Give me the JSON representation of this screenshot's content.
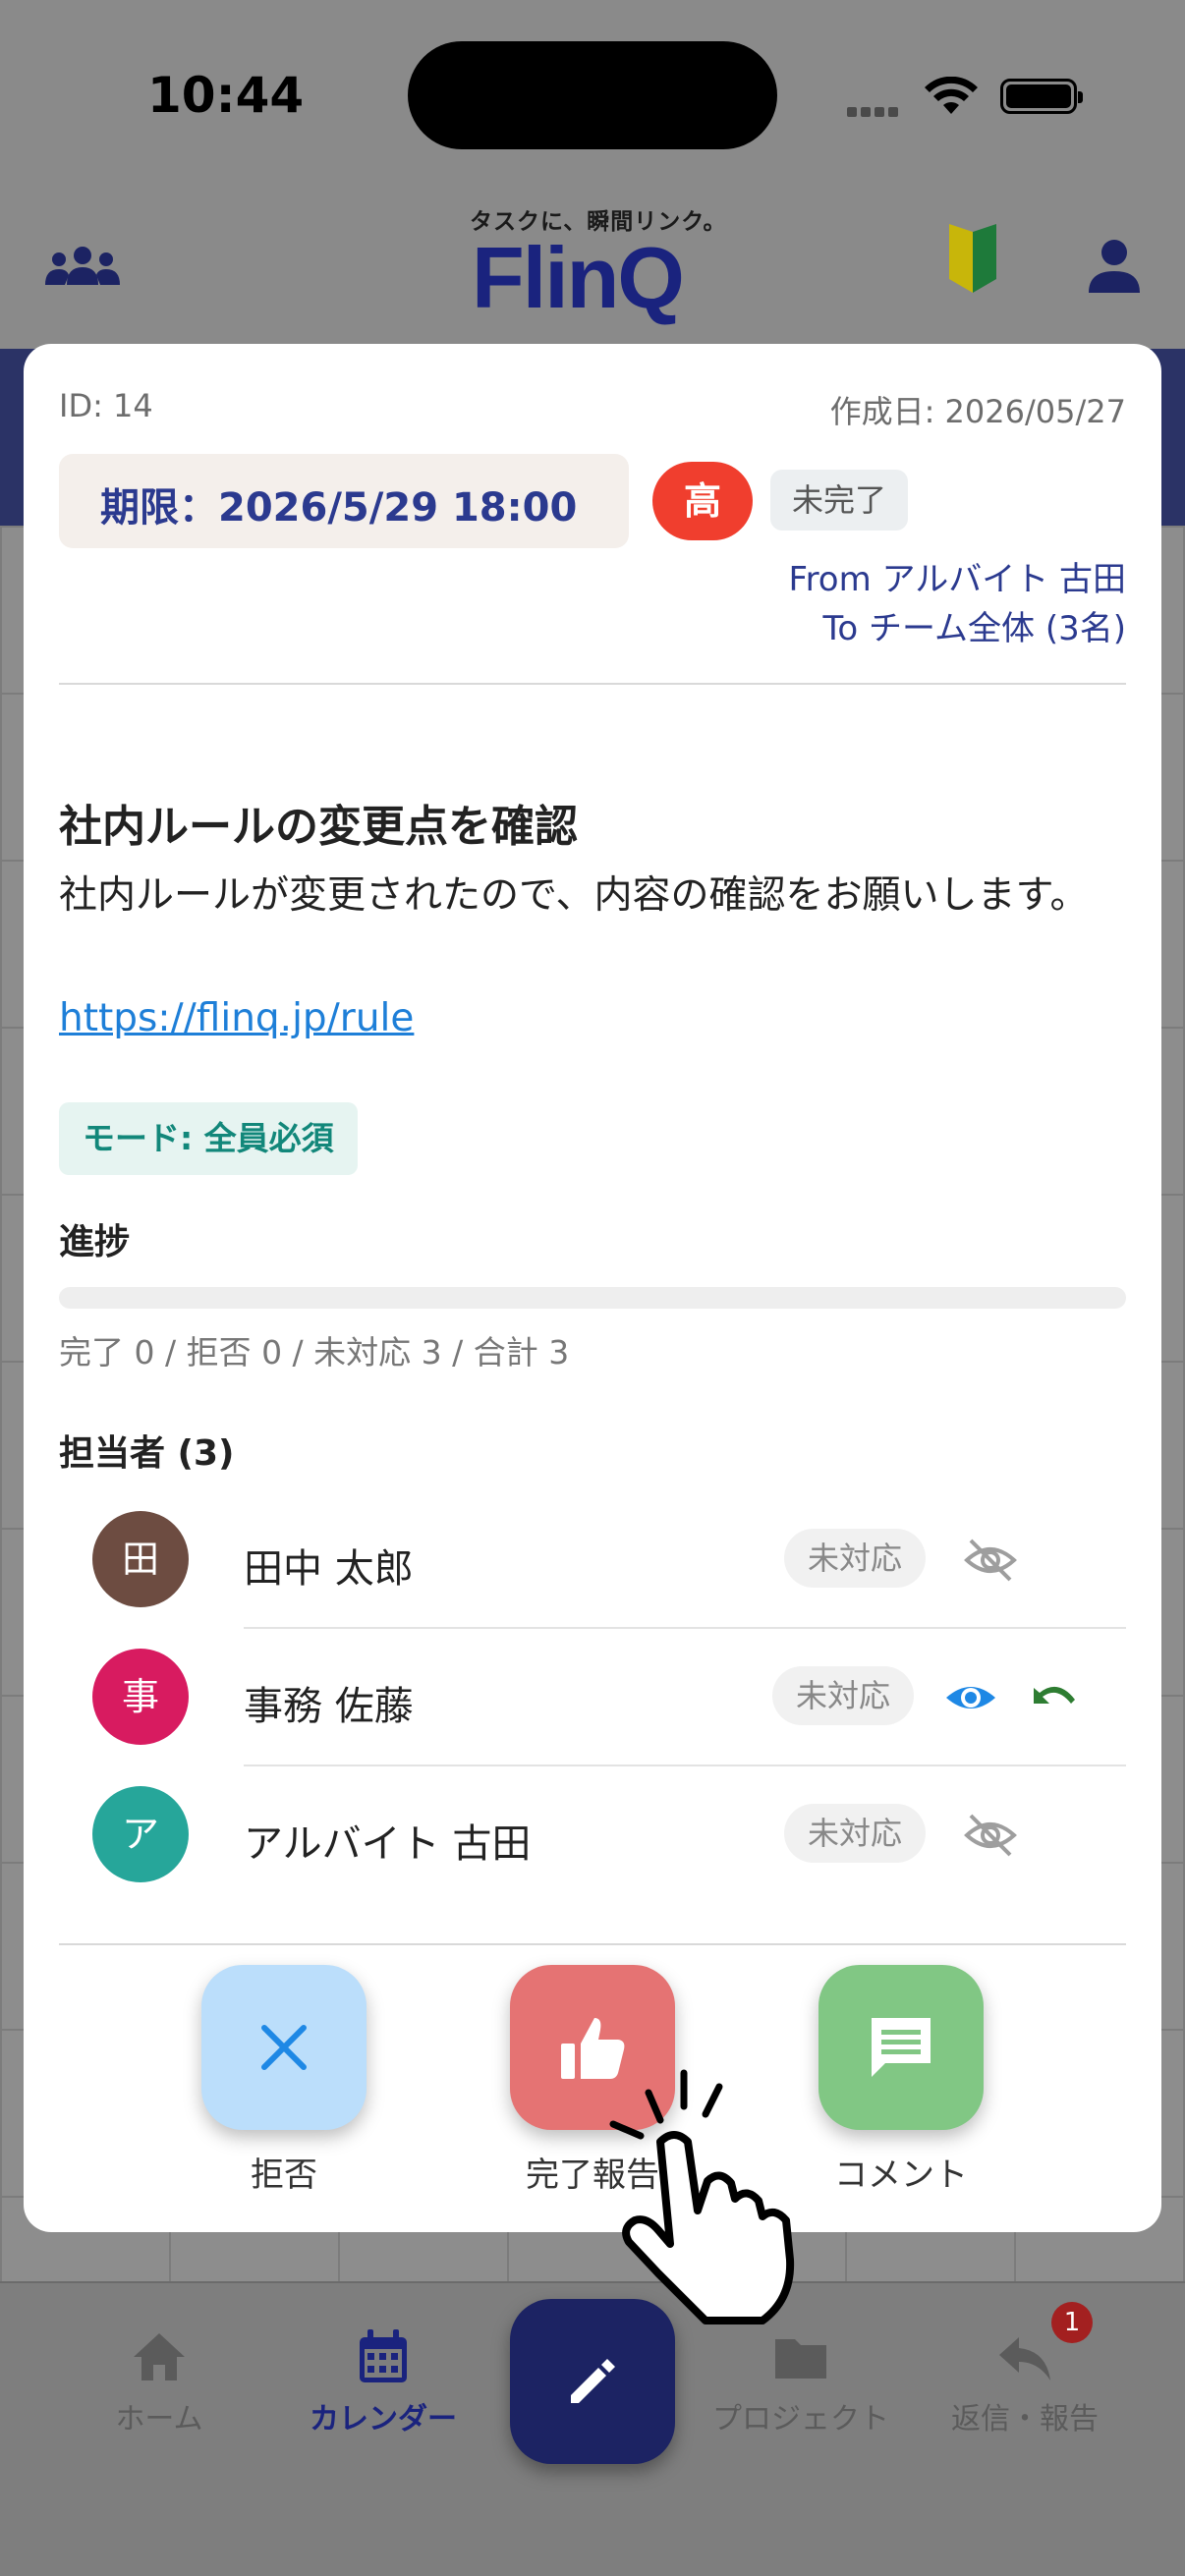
{
  "status_bar": {
    "time": "10:44"
  },
  "header": {
    "tagline": "タスクに、瞬間リンク。",
    "logo": "FlinQ"
  },
  "task": {
    "id_label": "ID: 14",
    "created_label": "作成日: 2026/05/27",
    "deadline_label": "期限：2026/5/29 18:00",
    "priority": "高",
    "status": "未完了",
    "from": "From アルバイト 古田",
    "to": "To チーム全体 (3名)",
    "title": "社内ルールの変更点を確認",
    "body": "社内ルールが変更されたので、内容の確認をお願いします。",
    "link": "https://flinq.jp/rule",
    "mode": "モード: 全員必須",
    "progress_heading": "進捗",
    "progress_value": 0,
    "progress_summary": "完了 0 / 拒否 0 / 未対応 3 / 合計 3",
    "assignee_heading": "担当者 (3)",
    "assignees": [
      {
        "initial": "田",
        "name": "田中 太郎",
        "status": "未対応",
        "color": "#6d4c41"
      },
      {
        "initial": "事",
        "name": "事務 佐藤",
        "status": "未対応",
        "color": "#d81b60"
      },
      {
        "initial": "ア",
        "name": "アルバイト 古田",
        "status": "未対応",
        "color": "#26a69a"
      }
    ]
  },
  "actions": {
    "reject": "拒否",
    "complete": "完了報告",
    "comment": "コメント"
  },
  "bottom_nav": {
    "home": "ホーム",
    "calendar": "カレンダー",
    "project": "プロジェクト",
    "reply": "返信・報告",
    "reply_badge": "1"
  },
  "colors": {
    "brand": "#1a237e",
    "priority_high": "#f03e2e",
    "reject_btn": "#bbdefb",
    "complete_btn": "#e57373",
    "comment_btn": "#81c784",
    "link": "#1e7fd8"
  }
}
